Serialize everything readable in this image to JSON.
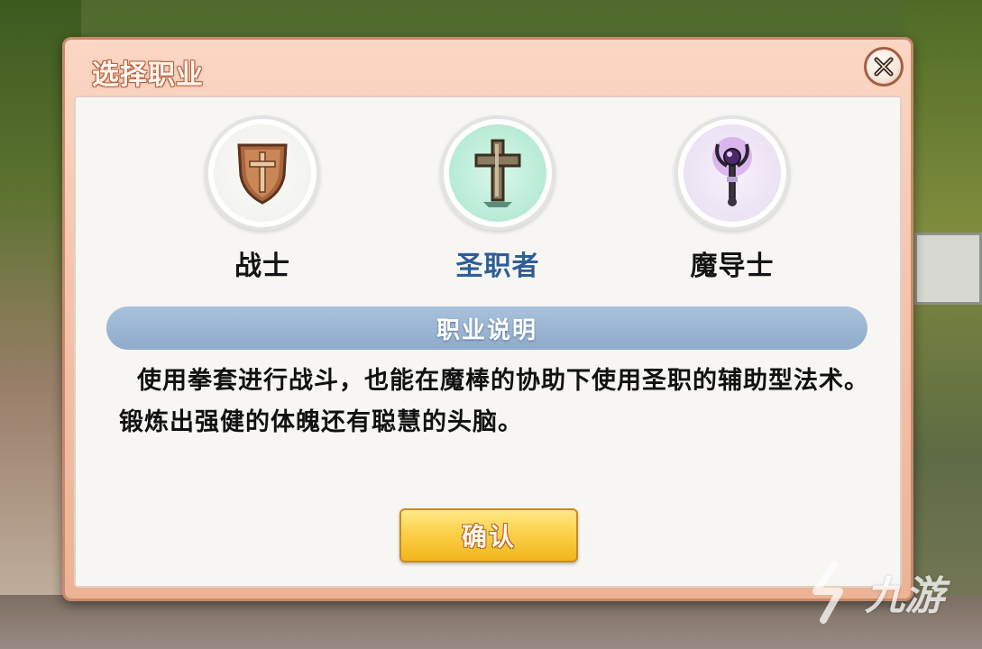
{
  "dialog": {
    "title": "选择职业",
    "close_icon": "close-x-icon"
  },
  "classes": [
    {
      "label": "战士",
      "icon": "shield-sword-icon",
      "selected": false
    },
    {
      "label": "圣职者",
      "icon": "holy-cross-icon",
      "selected": true
    },
    {
      "label": "魔导士",
      "icon": "magic-staff-icon",
      "selected": false
    }
  ],
  "description": {
    "header": "职业说明",
    "text": "使用拳套进行战斗，也能在魔棒的协助下使用圣职的辅助型法术。锻炼出强健的体魄还有聪慧的头脑。"
  },
  "confirm_label": "确认",
  "watermark": {
    "text": "九游",
    "icon": "nine-game-logo-icon"
  },
  "colors": {
    "selected_label": "#2e5e97",
    "frame": "#f3c2aa",
    "header_bar": "#8eabcb",
    "confirm_button": "#fcd14a"
  }
}
